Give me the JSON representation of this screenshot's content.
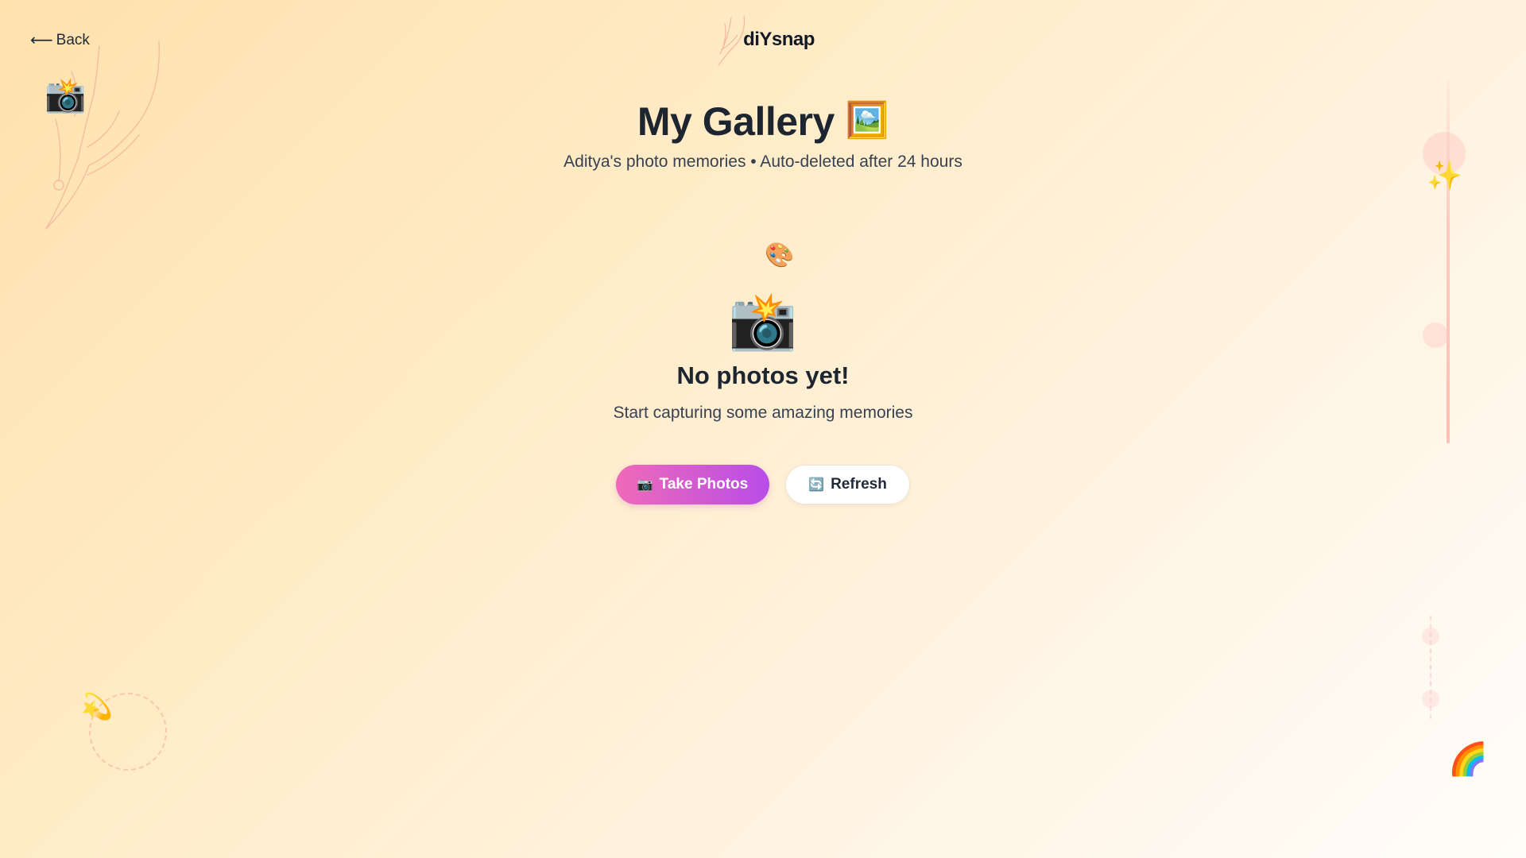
{
  "nav": {
    "back_arrow": "⟵",
    "back_label": "Back"
  },
  "brand": {
    "name": "diYsnap"
  },
  "header": {
    "title": "My Gallery",
    "title_emoji": "🖼️",
    "subtitle": "Aditya's photo memories • Auto-deleted after 24 hours"
  },
  "empty_state": {
    "palette_emoji": "🎨",
    "camera_emoji": "📸",
    "title": "No photos yet!",
    "message": "Start capturing some amazing memories"
  },
  "actions": {
    "take_photos_icon": "📷",
    "take_photos_label": "Take Photos",
    "refresh_icon": "🔄",
    "refresh_label": "Refresh"
  },
  "decorations": {
    "camera": "📸",
    "sparkles": "✨",
    "dizzy": "💫",
    "rainbow": "🌈"
  },
  "colors": {
    "background_start": "#ffe1ae",
    "background_end": "#fffdf9",
    "primary_gradient_start": "#ef6ab8",
    "primary_gradient_end": "#b84de8",
    "text": "#1c2530",
    "sketch": "#f4b29a"
  }
}
